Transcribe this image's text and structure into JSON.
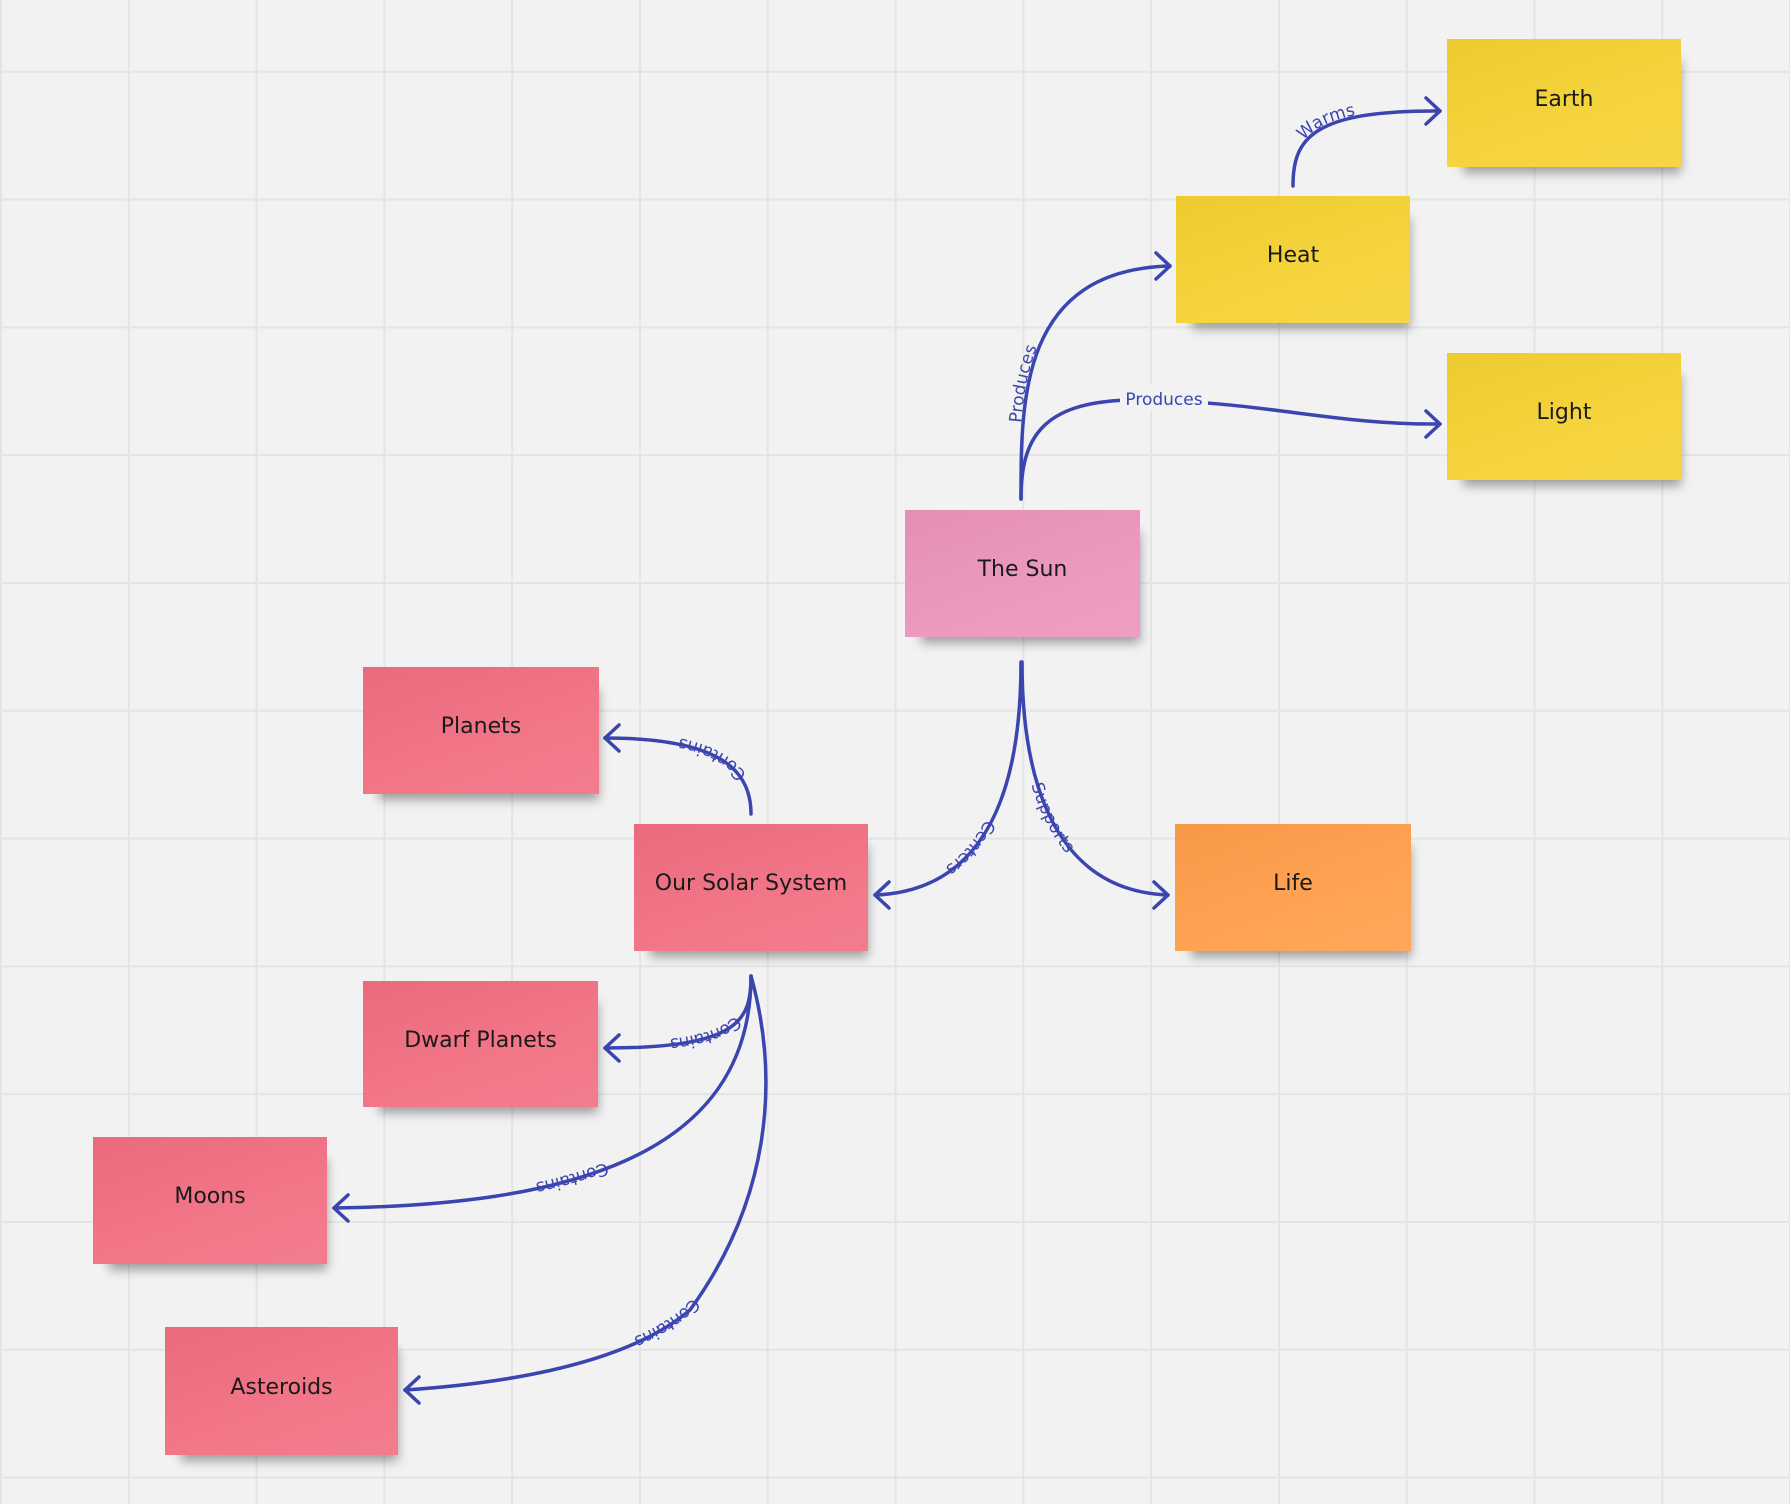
{
  "board": {
    "background_color": "#f2f2f2",
    "connector_color": "#3a45b0"
  },
  "stickies": [
    {
      "id": "earth",
      "text": "Earth",
      "color": "#f5d131"
    },
    {
      "id": "heat",
      "text": "Heat",
      "color": "#f5d131"
    },
    {
      "id": "light",
      "text": "Light",
      "color": "#f5d131"
    },
    {
      "id": "sun",
      "text": "The Sun",
      "color": "#ec93bb"
    },
    {
      "id": "planets",
      "text": "Planets",
      "color": "#f16e81"
    },
    {
      "id": "solar",
      "text": "Our Solar System",
      "color": "#f16e81"
    },
    {
      "id": "life",
      "text": "Life",
      "color": "#ff9d48"
    },
    {
      "id": "dwarf",
      "text": "Dwarf Planets",
      "color": "#f16e81"
    },
    {
      "id": "moons",
      "text": "Moons",
      "color": "#f16e81"
    },
    {
      "id": "asteroids",
      "text": "Asteroids",
      "color": "#f16e81"
    }
  ],
  "connectors": [
    {
      "from": "sun",
      "to": "heat",
      "label": "Produces"
    },
    {
      "from": "sun",
      "to": "light",
      "label": "Produces"
    },
    {
      "from": "heat",
      "to": "earth",
      "label": "Warms"
    },
    {
      "from": "sun",
      "to": "solar",
      "label": "Centers"
    },
    {
      "from": "sun",
      "to": "life",
      "label": "Supports"
    },
    {
      "from": "solar",
      "to": "planets",
      "label": "Contains"
    },
    {
      "from": "solar",
      "to": "dwarf",
      "label": "Contains"
    },
    {
      "from": "solar",
      "to": "moons",
      "label": "Contains"
    },
    {
      "from": "solar",
      "to": "asteroids",
      "label": "Contains"
    }
  ]
}
